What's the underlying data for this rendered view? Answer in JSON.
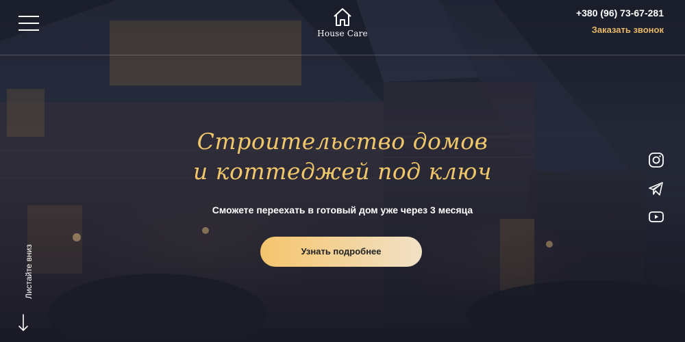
{
  "header": {
    "logo_text": "House Care",
    "phone": "+380 (96) 73-67-281",
    "callback_label": "Заказать звонок"
  },
  "hero": {
    "title_line1": "Строительство домов",
    "title_line2": "и коттеджей под ключ",
    "subtitle": "Сможете переехать в готовый дом уже через 3 месяца",
    "cta_label": "Узнать подробнее"
  },
  "social": {
    "items": [
      {
        "icon": "instagram-icon"
      },
      {
        "icon": "telegram-icon"
      },
      {
        "icon": "youtube-icon"
      }
    ]
  },
  "scroll": {
    "label": "Листайте вниз"
  },
  "colors": {
    "accent": "#e8b968",
    "title": "#f0c66a",
    "background": "#23263a"
  }
}
